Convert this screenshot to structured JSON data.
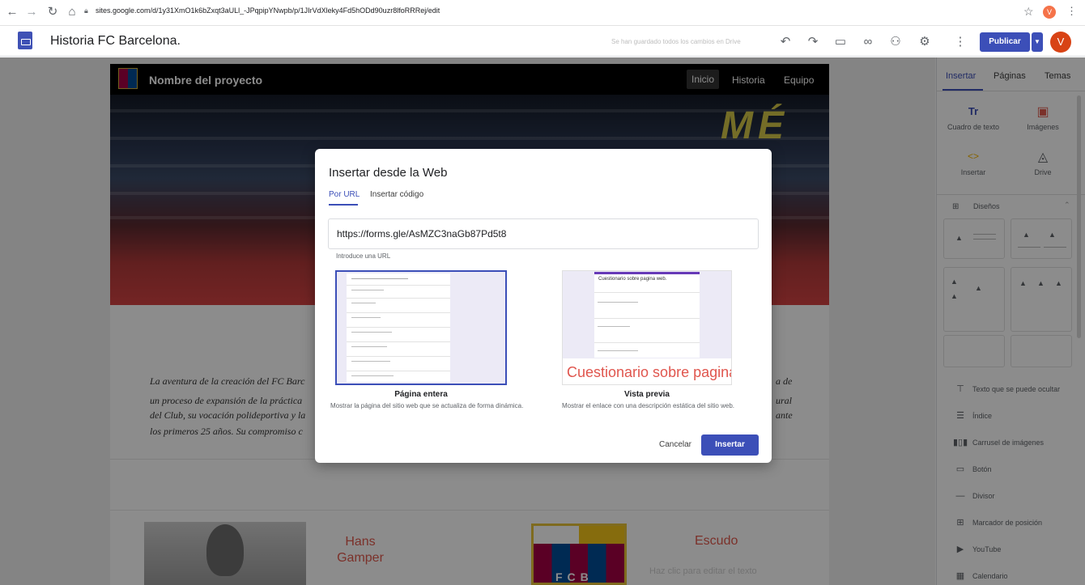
{
  "browser": {
    "url": "sites.google.com/d/1y31XmO1k6bZxqt3aULl_-JPqpipYNwpb/p/1JIrVdXleky4Fd5hODd90uzr8lfoRRRej/edit",
    "avatar_letter": "V"
  },
  "app": {
    "title": "Historia FC Barcelona.",
    "save_status": "Se han guardado todos los cambios en Drive",
    "publish_label": "Publicar",
    "user_avatar": "V"
  },
  "site": {
    "project_name": "Nombre del proyecto",
    "nav": [
      "Inicio",
      "Historia",
      "Equipo"
    ],
    "hero_text": "MÉ",
    "body_left": [
      "La aventura de la creación del FC Barc",
      "un proceso de expansión de la práctica",
      "del Club, su vocación polideportiva y la",
      "los primeros 25 años. Su compromiso c"
    ],
    "body_right": [
      "a de",
      "ural",
      "ante"
    ],
    "hans_title": "Hans Gamper",
    "shield_text": "FCB",
    "escudo_title": "Escudo",
    "escudo_placeholder": "Haz clic para editar el texto"
  },
  "panel": {
    "tabs": [
      "Insertar",
      "Páginas",
      "Temas"
    ],
    "insert_tiles": [
      {
        "label": "Cuadro de texto",
        "icon": "text-box-icon"
      },
      {
        "label": "Imágenes",
        "icon": "image-icon"
      },
      {
        "label": "Insertar",
        "icon": "embed-code-icon"
      },
      {
        "label": "Drive",
        "icon": "drive-icon"
      }
    ],
    "layouts_label": "Diseños",
    "items": [
      {
        "label": "Texto que se puede ocultar",
        "icon": "collapsible-text-icon"
      },
      {
        "label": "Índice",
        "icon": "toc-icon"
      },
      {
        "label": "Carrusel de imágenes",
        "icon": "carousel-icon"
      },
      {
        "label": "Botón",
        "icon": "button-icon"
      },
      {
        "label": "Divisor",
        "icon": "divider-icon"
      },
      {
        "label": "Marcador de posición",
        "icon": "placeholder-icon"
      },
      {
        "label": "YouTube",
        "icon": "youtube-icon"
      },
      {
        "label": "Calendario",
        "icon": "calendar-icon"
      }
    ]
  },
  "dialog": {
    "title": "Insertar desde la Web",
    "tabs": [
      "Por URL",
      "Insertar código"
    ],
    "url_value": "https://forms.gle/AsMZC3naGb87Pd5t8",
    "url_helper": "Introduce una URL",
    "options": [
      {
        "label": "Página entera",
        "description": "Mostrar la página del sitio web que se actualiza de forma dinámica."
      },
      {
        "label": "Vista previa",
        "description": "Mostrar el enlace con una descripción estática del sitio web."
      }
    ],
    "preview_card_title": "Cuestionario sobre pagina web.",
    "preview_big_text": "Cuestionario sobre pagina",
    "cancel_label": "Cancelar",
    "insert_label": "Insertar"
  },
  "colors": {
    "accent": "#3c4fb8",
    "publish": "#3c4fb8",
    "title_red": "#e05a4e"
  }
}
